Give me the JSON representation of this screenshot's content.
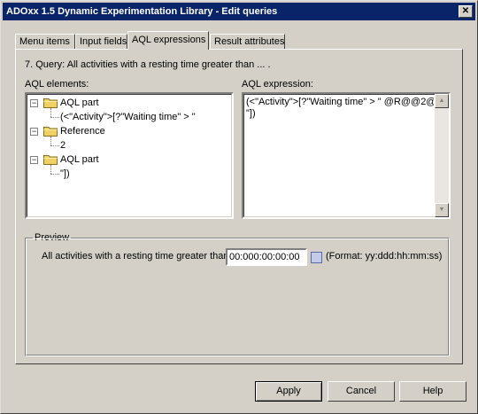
{
  "window": {
    "title": "ADOxx 1.5 Dynamic Experimentation Library - Edit queries",
    "close_label": "✕"
  },
  "tabs": [
    {
      "label": "Menu items",
      "active": false
    },
    {
      "label": "Input fields",
      "active": false
    },
    {
      "label": "AQL expressions",
      "active": true
    },
    {
      "label": "Result attributes",
      "active": false
    }
  ],
  "query_label": "7. Query: All activities with a resting time greater than ... .",
  "aql_elements": {
    "label": "AQL elements:",
    "tree": [
      {
        "text": "AQL part",
        "type": "folder",
        "expander": "−"
      },
      {
        "text": "(<\"Activity\">[?\"Waiting time\" > \"",
        "type": "leaf"
      },
      {
        "text": "Reference",
        "type": "folder",
        "expander": "−"
      },
      {
        "text": "2",
        "type": "leaf"
      },
      {
        "text": "AQL part",
        "type": "folder",
        "expander": "−"
      },
      {
        "text": "\"])",
        "type": "leaf"
      }
    ]
  },
  "aql_expression": {
    "label": "AQL expression:",
    "value_line1": "(<\"Activity\">[?\"Waiting time\" > \" @R@@2@",
    "value_line2": "\"])"
  },
  "preview": {
    "legend": "Preview",
    "prompt": "All activities with a resting time greater than",
    "time_value": "00:000:00:00:00",
    "format_hint": "(Format: yy:ddd:hh:mm:ss)"
  },
  "buttons": {
    "apply": "Apply",
    "cancel": "Cancel",
    "help": "Help"
  }
}
